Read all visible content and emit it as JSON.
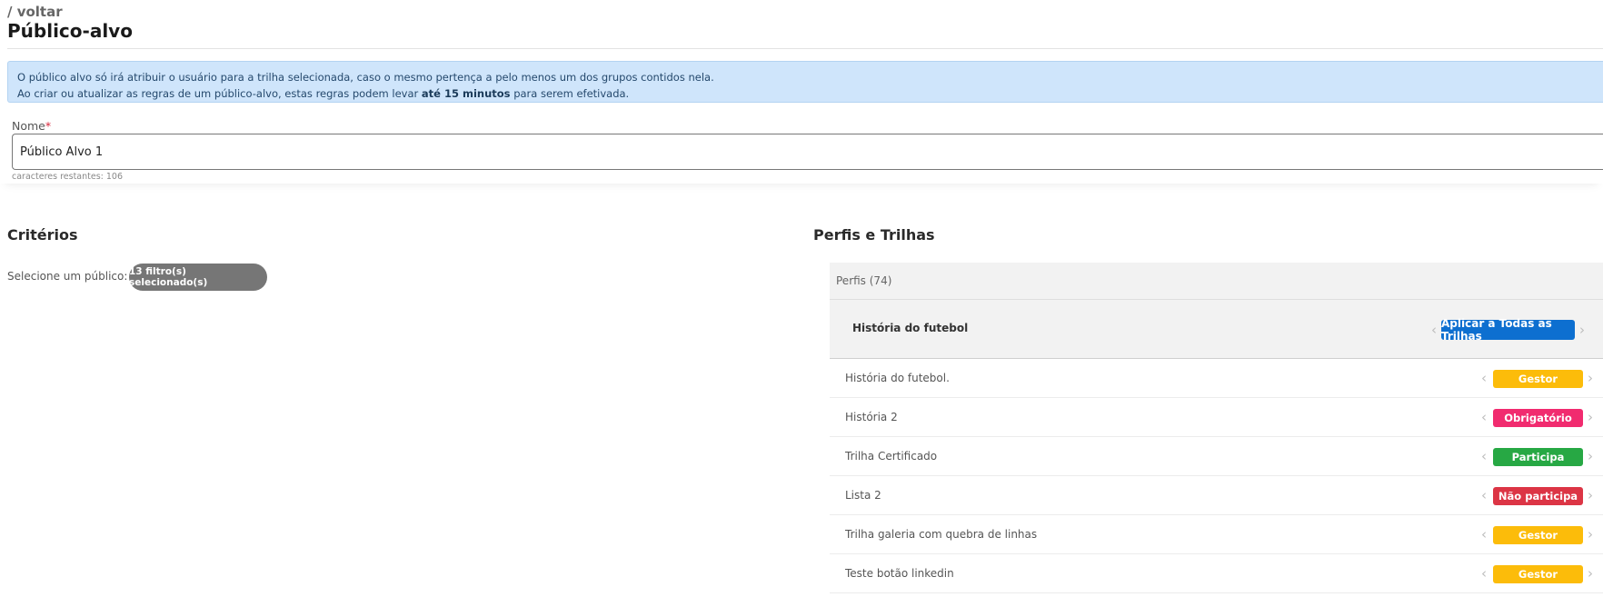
{
  "header": {
    "back_label": "/ voltar",
    "title": "Público-alvo"
  },
  "alert": {
    "line1": "O público alvo só irá atribuir o usuário para a trilha selecionada, caso o mesmo pertença a pelo menos um dos grupos contidos nela.",
    "line2_before": "Ao criar ou atualizar as regras de um público-alvo, estas regras podem levar ",
    "line2_bold": "até 15 minutos",
    "line2_after": " para serem efetivada."
  },
  "name_field": {
    "label": "Nome",
    "required_mark": "*",
    "value": "Público Alvo 1",
    "counter": "caracteres restantes: 106"
  },
  "criteria": {
    "title": "Critérios",
    "select_label": "Selecione um público:",
    "filters_button": "13 filtro(s) selecionado(s)"
  },
  "profiles": {
    "title": "Perfis e Trilhas",
    "header_label": "Perfis (74)",
    "profile_name": "História do futebol",
    "apply_all_label": "Aplicar a Todas as Trilhas",
    "tracks": [
      {
        "name": "História do futebol.",
        "status": "Gestor",
        "color": "#fcbc0a"
      },
      {
        "name": "História 2",
        "status": "Obrigatório",
        "color": "#f12b6f"
      },
      {
        "name": "Trilha Certificado",
        "status": "Participa",
        "color": "#27a844"
      },
      {
        "name": "Lista 2",
        "status": "Não participa",
        "color": "#dc3545"
      },
      {
        "name": "Trilha galeria com quebra de linhas",
        "status": "Gestor",
        "color": "#fcbc0a"
      },
      {
        "name": "Teste botão linkedin",
        "status": "Gestor",
        "color": "#fcbc0a"
      }
    ]
  },
  "icons": {
    "chevron_left": "chevron-left-icon",
    "chevron_right": "chevron-right-icon"
  }
}
